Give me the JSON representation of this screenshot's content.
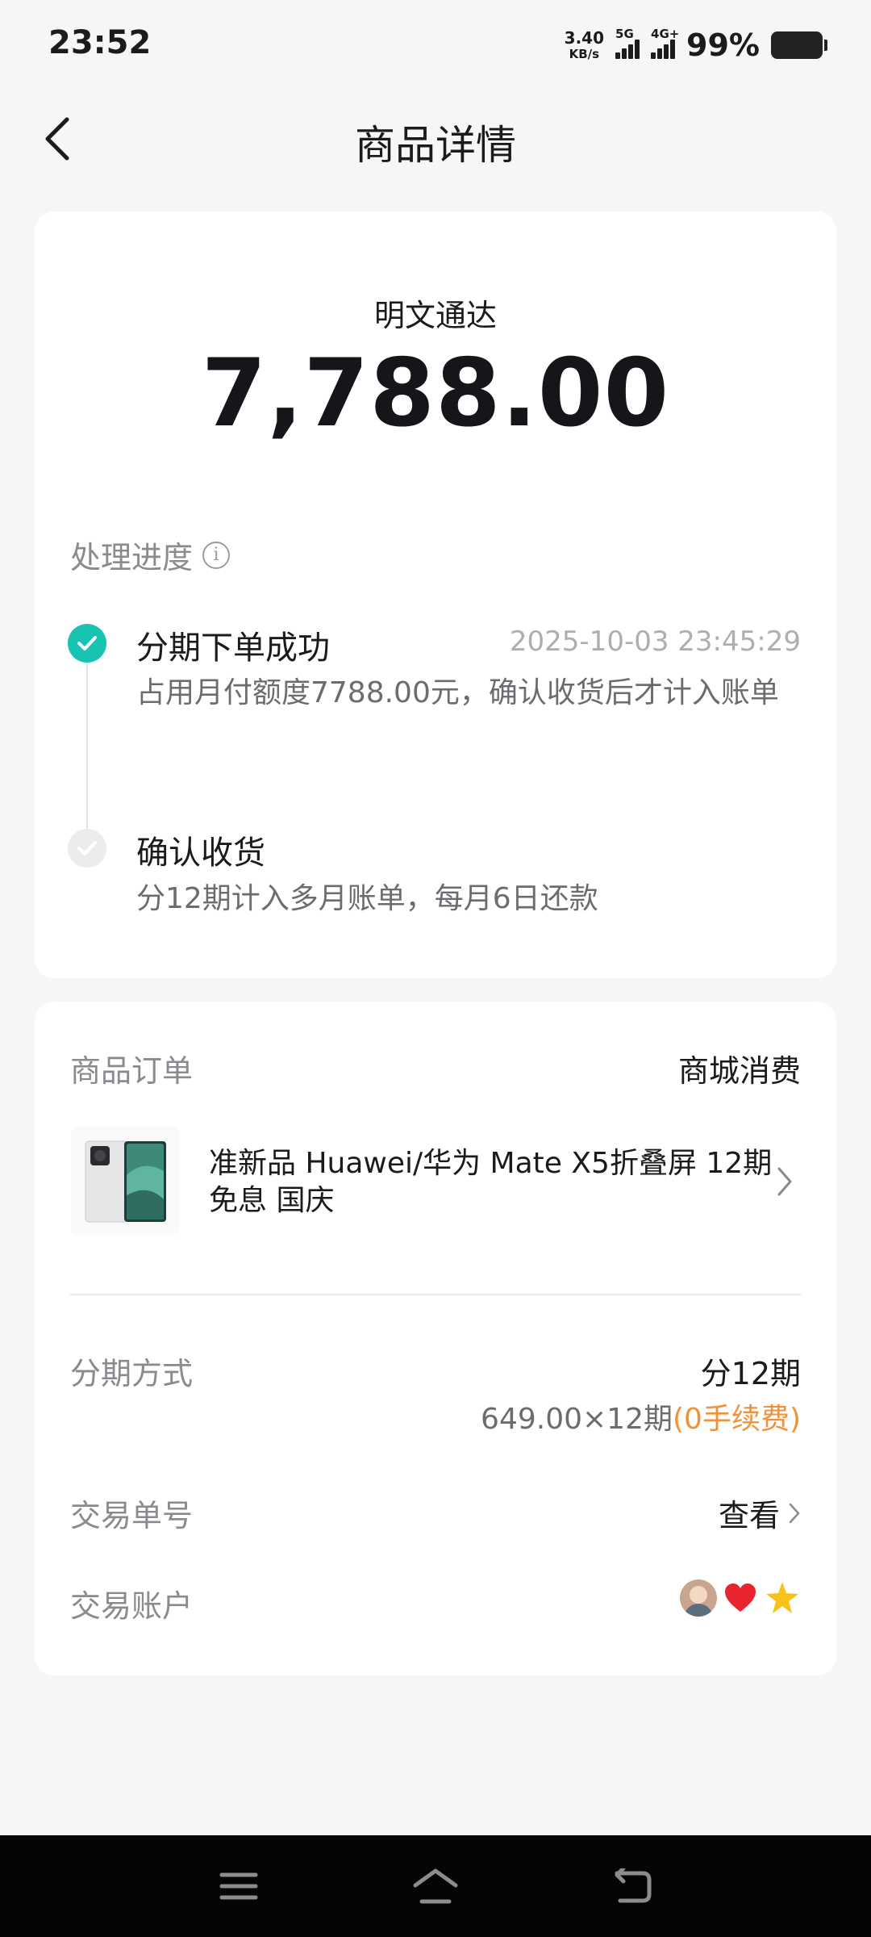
{
  "status_bar": {
    "time": "23:52",
    "net_speed_value": "3.40",
    "net_speed_unit": "KB/s",
    "sim1_tag": "5G",
    "sim2_tag": "4G+",
    "battery": "99%"
  },
  "header": {
    "title": "商品详情"
  },
  "summary": {
    "merchant": "明文通达",
    "amount": "7,788.00"
  },
  "progress": {
    "label": "处理进度",
    "steps": [
      {
        "title": "分期下单成功",
        "time": "2025-10-03 23:45:29",
        "desc": "占用月付额度7788.00元，确认收货后才计入账单",
        "status": "done"
      },
      {
        "title": "确认收货",
        "desc": "分12期计入多月账单，每月6日还款",
        "status": "pending"
      }
    ]
  },
  "order": {
    "label": "商品订单",
    "type": "商城消费",
    "product_title": "准新品 Huawei/华为 Mate X5折叠屏 12期免息 国庆"
  },
  "installment": {
    "label": "分期方式",
    "value": "分12期",
    "detail": "649.00×12期",
    "fee": "(0手续费)"
  },
  "transaction": {
    "label": "交易单号",
    "action": "查看"
  },
  "account": {
    "label": "交易账户",
    "icons": [
      "avatar",
      "heart-icon",
      "star-icon"
    ]
  },
  "colors": {
    "accent": "#19c3b2",
    "fee": "#f0923b",
    "background": "#f6f6f7"
  }
}
